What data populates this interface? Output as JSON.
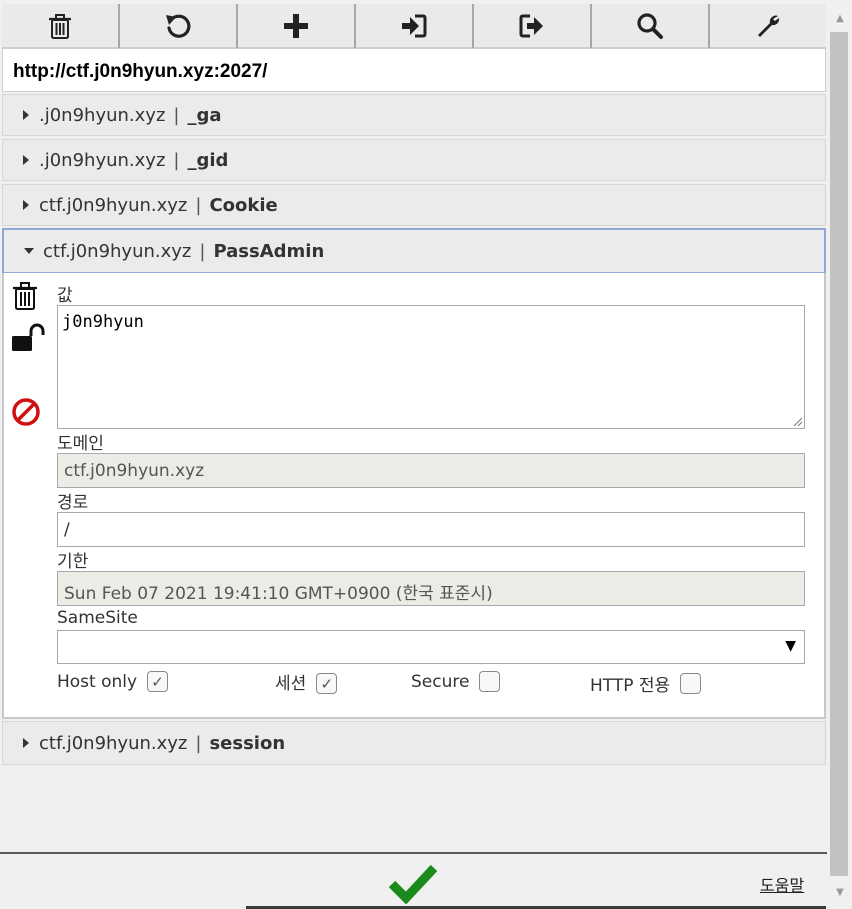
{
  "toolbar": {
    "buttons": [
      {
        "name": "delete-all",
        "icon": "trash-icon"
      },
      {
        "name": "reset",
        "icon": "undo-icon"
      },
      {
        "name": "add",
        "icon": "plus-icon"
      },
      {
        "name": "import",
        "icon": "import-icon"
      },
      {
        "name": "export",
        "icon": "export-icon"
      },
      {
        "name": "search",
        "icon": "search-icon"
      },
      {
        "name": "options",
        "icon": "wrench-icon"
      }
    ]
  },
  "url": "http://ctf.j0n9hyun.xyz:2027/",
  "cookies": [
    {
      "domain": ".j0n9hyun.xyz",
      "separator": "|",
      "name": "_ga"
    },
    {
      "domain": ".j0n9hyun.xyz",
      "separator": "|",
      "name": "_gid"
    },
    {
      "domain": "ctf.j0n9hyun.xyz",
      "separator": "|",
      "name": "Cookie"
    },
    {
      "domain": "ctf.j0n9hyun.xyz",
      "separator": "|",
      "name": "PassAdmin",
      "expanded": true
    },
    {
      "domain": "ctf.j0n9hyun.xyz",
      "separator": "|",
      "name": "session"
    }
  ],
  "detail": {
    "value_label": "값",
    "value": "j0n9hyun",
    "domain_label": "도메인",
    "domain": "ctf.j0n9hyun.xyz",
    "path_label": "경로",
    "path": "/",
    "expiry_label": "기한",
    "expiry": "Sun Feb 07 2021 19:41:10 GMT+0900 (한국 표준시)",
    "samesite_label": "SameSite",
    "samesite_value": "",
    "checkboxes": [
      {
        "label": "Host only",
        "checked": true
      },
      {
        "label": "세션",
        "checked": true
      },
      {
        "label": "Secure",
        "checked": false
      },
      {
        "label": "HTTP 전용",
        "checked": false
      }
    ],
    "side_icons": [
      "trash-icon",
      "unlock-icon",
      "block-icon"
    ]
  },
  "footer": {
    "save_icon": "checkmark-icon",
    "save_color": "#1a8a1a",
    "help": "도움말"
  },
  "colors": {
    "accent_border": "#90a8d8",
    "block_red": "#d01010"
  }
}
